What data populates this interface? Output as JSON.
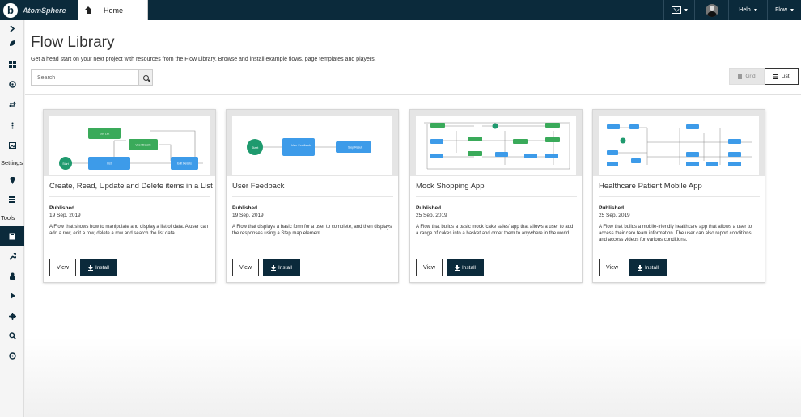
{
  "app": {
    "brand_letter": "b",
    "brand_name": "AtomSphere"
  },
  "topbar": {
    "home_tab": "Home",
    "help_label": "Help",
    "flow_label": "Flow"
  },
  "sidebar": {
    "settings_label": "Settings",
    "tools_label": "Tools"
  },
  "page": {
    "title": "Flow Library",
    "description": "Get a head start on your next project with resources from the Flow Library. Browse and install example flows, page templates and players.",
    "search_placeholder": "Search",
    "view_grid": "Grid",
    "view_list": "List",
    "active_view": "List"
  },
  "cards": [
    {
      "title": "Create, Read, Update and Delete items in a List",
      "published_label": "Published",
      "date": "19 Sep. 2019",
      "description": "A Flow that shows how to manipulate and display a list of data. A user can add a row, edit a row, delete a row and search the list data.",
      "view_label": "View",
      "install_label": "Install"
    },
    {
      "title": "User Feedback",
      "published_label": "Published",
      "date": "19 Sep. 2019",
      "description": "A Flow that displays a basic form for a user to complete, and then displays the responses using a Step map element.",
      "view_label": "View",
      "install_label": "Install"
    },
    {
      "title": "Mock Shopping App",
      "published_label": "Published",
      "date": "25 Sep. 2019",
      "description": "A Flow that builds a basic mock 'cake sales' app that allows a user to add a range of cakes into a basket and order them to anywhere in the world.",
      "view_label": "View",
      "install_label": "Install"
    },
    {
      "title": "Healthcare Patient Mobile App",
      "published_label": "Published",
      "date": "25 Sep. 2019",
      "description": "A Flow that builds a mobile-friendly healthcare app that allows a user to access their care team information. The user can also report conditions and access videos for various conditions.",
      "view_label": "View",
      "install_label": "Install"
    }
  ],
  "thumbnails": {
    "card1": {
      "start": "Start",
      "nodes": [
        "Edit List",
        "User Details",
        "List",
        "Edit Details"
      ]
    },
    "card2": {
      "start": "Start",
      "nodes": [
        "User Feedback",
        "Step Result"
      ]
    }
  },
  "colors": {
    "topbar": "#0b2a3b",
    "install_button": "#0b2a3b",
    "flow_green": "#3aaa5a",
    "flow_blue": "#3d9be9",
    "start_node": "#1f9a6e"
  }
}
